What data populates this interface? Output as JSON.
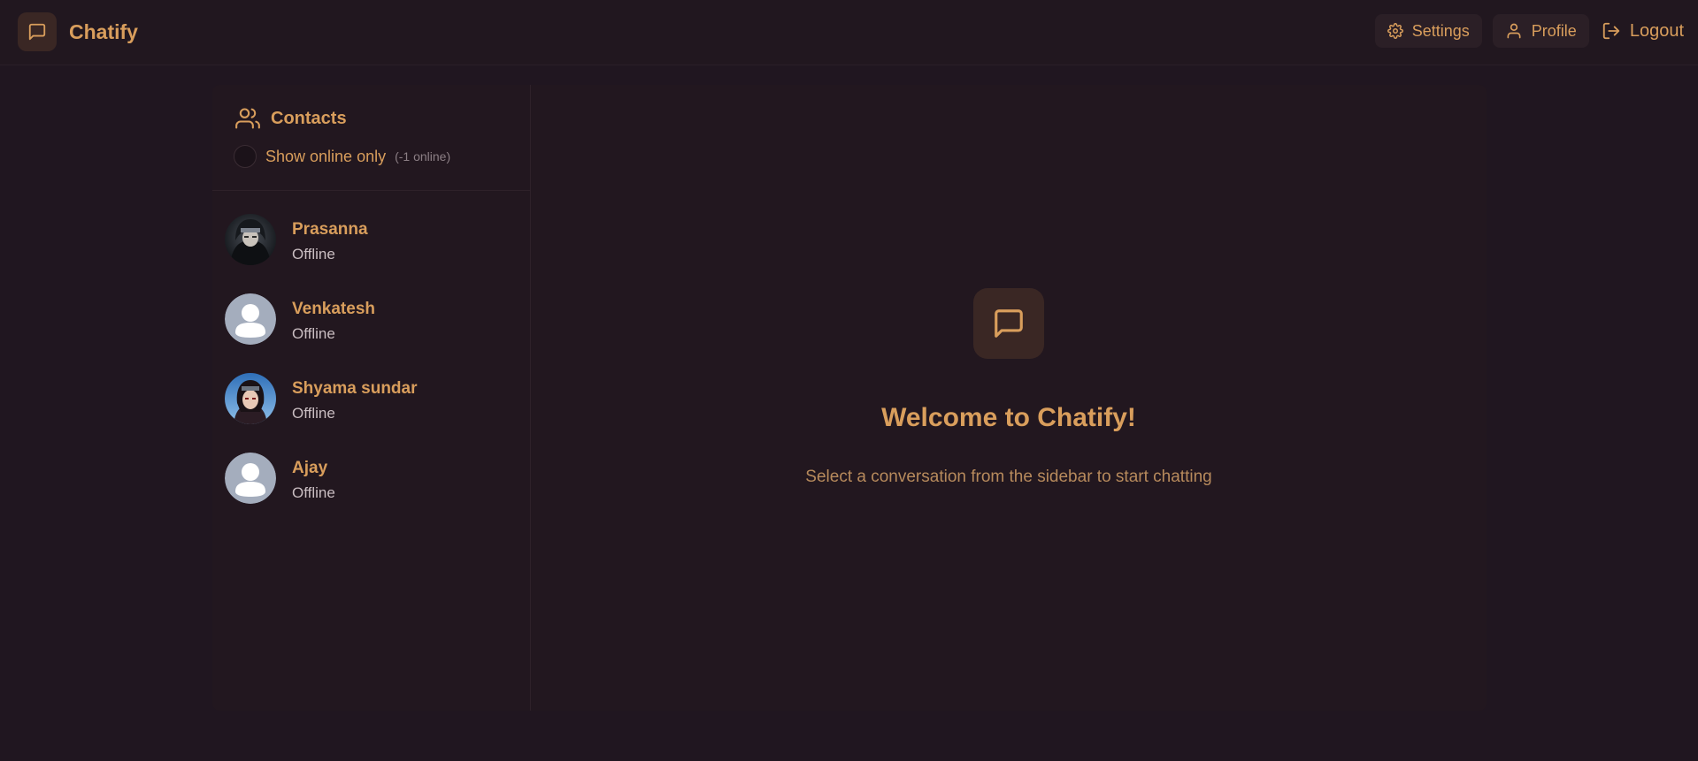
{
  "app": {
    "title": "Chatify",
    "accent_color": "#d99e5c",
    "background_color": "#201620"
  },
  "header": {
    "logo_icon": "message-square-icon",
    "nav": {
      "settings_label": "Settings",
      "profile_label": "Profile",
      "logout_label": "Logout"
    }
  },
  "sidebar": {
    "title": "Contacts",
    "title_icon": "users-icon",
    "filter_label": "Show online only",
    "filter_checked": false,
    "online_count": "(-1 online)",
    "contacts": [
      {
        "name": "Prasanna",
        "status": "Offline",
        "avatar": "photo-dark-hooded-figure"
      },
      {
        "name": "Venkatesh",
        "status": "Offline",
        "avatar": "default-user-silhouette"
      },
      {
        "name": "Shyama sundar",
        "status": "Offline",
        "avatar": "photo-anime-character"
      },
      {
        "name": "Ajay",
        "status": "Offline",
        "avatar": "default-user-silhouette"
      }
    ]
  },
  "main": {
    "icon": "message-square-icon",
    "title": "Welcome to Chatify!",
    "subtitle": "Select a conversation from the sidebar to start chatting"
  }
}
